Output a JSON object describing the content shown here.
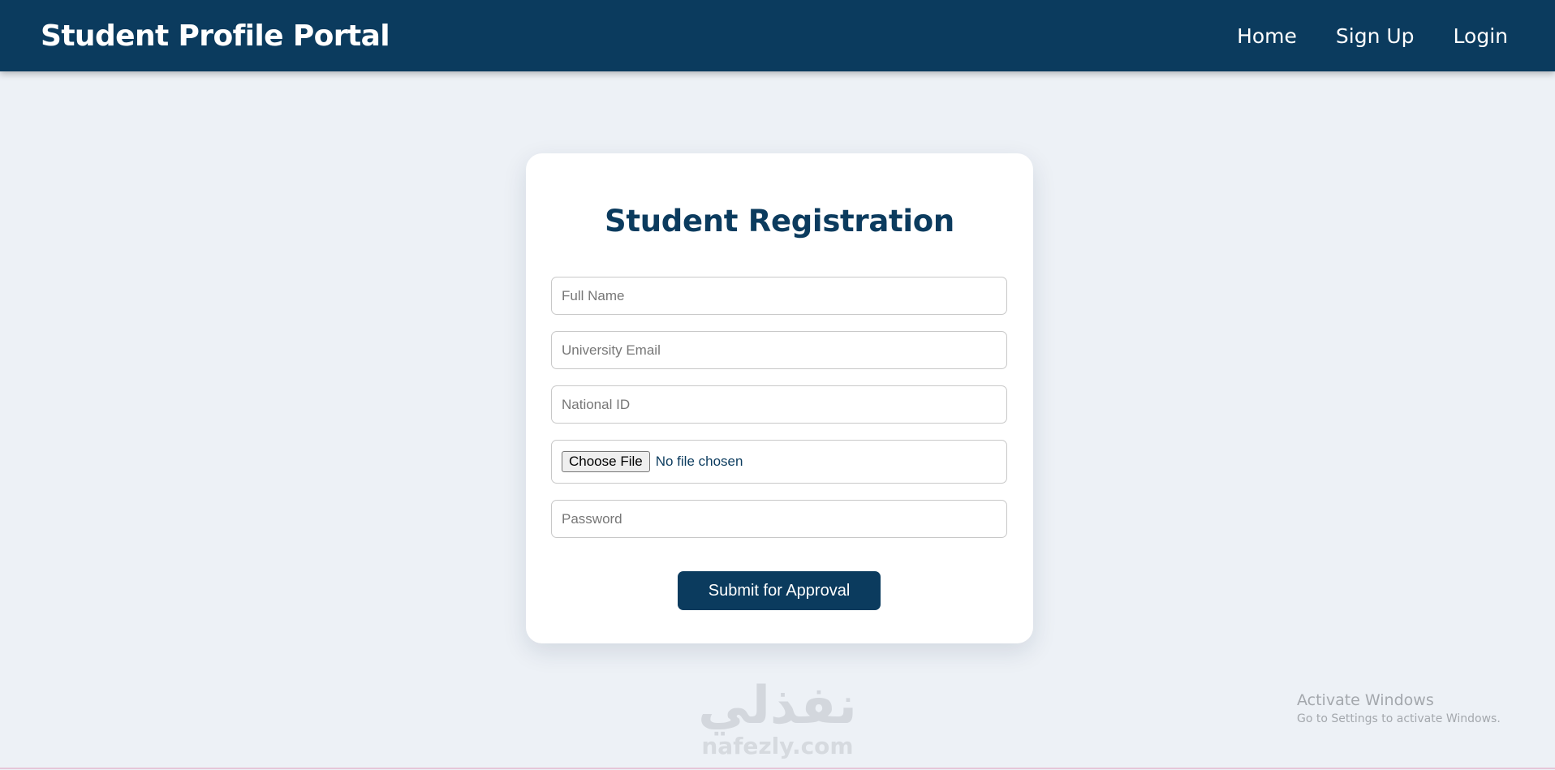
{
  "header": {
    "brand": "Student Profile Portal",
    "nav": [
      {
        "label": "Home"
      },
      {
        "label": "Sign Up"
      },
      {
        "label": "Login"
      }
    ]
  },
  "form": {
    "title": "Student Registration",
    "full_name_placeholder": "Full Name",
    "email_placeholder": "University Email",
    "national_id_placeholder": "National ID",
    "file_button_label": "Choose File",
    "file_status": "No file chosen",
    "password_placeholder": "Password",
    "submit_label": "Submit for Approval"
  },
  "watermark": {
    "arabic": "نفذلي",
    "url": "nafezly.com"
  },
  "windows_activation": {
    "title": "Activate Windows",
    "subtitle": "Go to Settings to activate Windows."
  },
  "colors": {
    "primary": "#0b3b5e",
    "background": "#edf1f6",
    "card": "#ffffff"
  }
}
